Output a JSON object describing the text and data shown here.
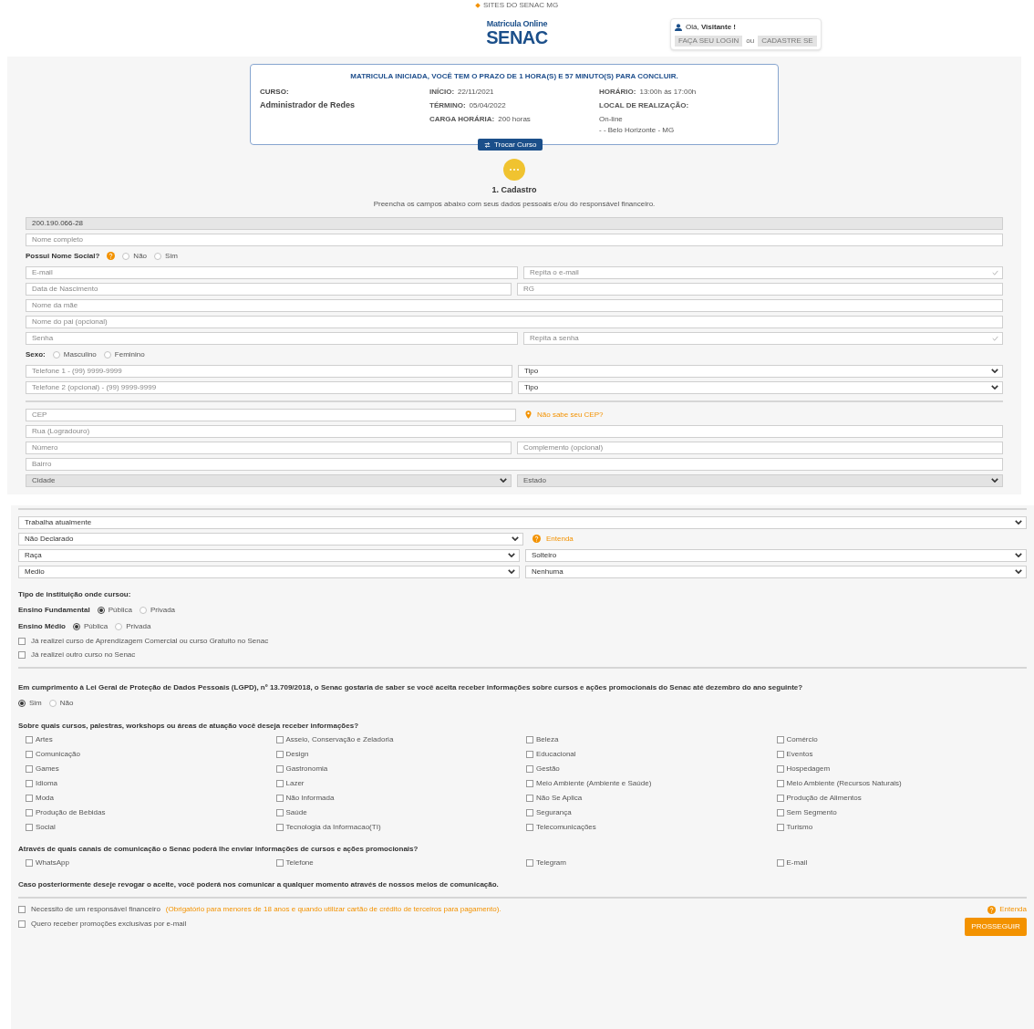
{
  "header": {
    "top_link": "SITES DO SENAC MG",
    "logo_line1": "Matricula Online",
    "logo_line2": "SENAC",
    "greeting": "Olá, **Visitante !**",
    "login_button": "FAÇA SEU LOGIN",
    "or": "ou",
    "register_button": "CADASTRE SE"
  },
  "enrollment": {
    "title": "MATRICULA INICIADA, VOCÊ TEM O PRAZO DE 1 HORA(S) E 57 MINUTO(S) PARA CONCLUIR.",
    "course_label": "CURSO:",
    "course": "Administrador de Redes",
    "details": [
      {
        "label": "INÍCIO:",
        "value": "22/11/2021"
      },
      {
        "label": "TÉRMINO:",
        "value": "05/04/2022"
      },
      {
        "label": "CARGA HORÁRIA:",
        "value": "200 horas"
      }
    ],
    "schedule": {
      "label": "HORÁRIO:",
      "value": "13:00h às 17:00h"
    },
    "location_label": "LOCAL DE REALIZAÇÃO:",
    "location_lines": [
      "On-line",
      "- - Belo Horizonte - MG"
    ],
    "change_button": "Trocar Curso"
  },
  "step": {
    "title": "1. Cadastro",
    "description": "Preencha os campos abaixo com seus dados pessoais e/ou do responsável financeiro."
  },
  "section_1": [
    {
      "kind": "fields",
      "fields": [
        {
          "kind": "input",
          "value": "200.190.066-28",
          "disabled": true
        }
      ]
    },
    {
      "kind": "fields",
      "fields": [
        {
          "kind": "input",
          "placeholder": "Nome completo"
        }
      ]
    },
    {
      "kind": "radios",
      "label": "Possui Nome Social?",
      "help": true,
      "options": [
        {
          "label": "Não",
          "selected": false
        },
        {
          "label": "Sim",
          "selected": false
        }
      ]
    },
    {
      "kind": "fields",
      "fields": [
        {
          "kind": "input",
          "placeholder": "E-mail"
        },
        {
          "kind": "confirm",
          "placeholder": "Repita o e-mail"
        }
      ]
    },
    {
      "kind": "fields",
      "fields": [
        {
          "kind": "input",
          "placeholder": "Data de Nascimento"
        },
        {
          "kind": "input",
          "placeholder": "RG"
        }
      ]
    },
    {
      "kind": "fields",
      "fields": [
        {
          "kind": "input",
          "placeholder": "Nome da mãe"
        }
      ]
    },
    {
      "kind": "fields",
      "fields": [
        {
          "kind": "input",
          "placeholder": "Nome do pai (opcional)"
        }
      ]
    },
    {
      "kind": "fields",
      "fields": [
        {
          "kind": "input",
          "placeholder": "Senha"
        },
        {
          "kind": "confirm",
          "placeholder": "Repita a senha"
        }
      ]
    },
    {
      "kind": "radios",
      "label": "Sexo:",
      "help": false,
      "options": [
        {
          "label": "Masculino",
          "selected": false
        },
        {
          "label": "Feminino",
          "selected": false
        }
      ]
    },
    {
      "kind": "fields",
      "fields": [
        {
          "kind": "input",
          "placeholder": "Telefone 1 - (99) 9999-9999"
        },
        {
          "kind": "select",
          "value": "Tipo"
        }
      ]
    },
    {
      "kind": "fields",
      "fields": [
        {
          "kind": "input",
          "placeholder": "Telefone 2 (opcional) - (99) 9999-9999"
        },
        {
          "kind": "select",
          "value": "Tipo"
        }
      ]
    },
    {
      "kind": "divider"
    },
    {
      "kind": "fields",
      "fields": [
        {
          "kind": "input",
          "placeholder": "CEP"
        },
        {
          "kind": "location-link",
          "text": "Não sabe seu CEP?"
        }
      ]
    },
    {
      "kind": "fields",
      "fields": [
        {
          "kind": "input",
          "placeholder": "Rua (Logradouro)"
        }
      ]
    },
    {
      "kind": "fields",
      "fields": [
        {
          "kind": "input",
          "placeholder": "Número"
        },
        {
          "kind": "input",
          "placeholder": "Complemento (opcional)"
        }
      ]
    },
    {
      "kind": "fields",
      "fields": [
        {
          "kind": "input",
          "placeholder": "Bairro"
        }
      ]
    },
    {
      "kind": "fields",
      "fields": [
        {
          "kind": "select",
          "value": "Cidade",
          "disabled": true
        },
        {
          "kind": "select",
          "value": "Estado",
          "disabled": true
        }
      ]
    }
  ],
  "section_2": [
    {
      "kind": "divider"
    },
    {
      "kind": "fields",
      "fields": [
        {
          "kind": "select",
          "value": "Trabalha atualmente"
        }
      ]
    },
    {
      "kind": "fields",
      "fields": [
        {
          "kind": "select",
          "value": "Não Declarado"
        },
        {
          "kind": "help-link",
          "text": "Entenda"
        }
      ]
    },
    {
      "kind": "fields",
      "fields": [
        {
          "kind": "select",
          "value": "Raça"
        },
        {
          "kind": "select",
          "value": "Solteiro"
        }
      ]
    },
    {
      "kind": "fields",
      "fields": [
        {
          "kind": "select",
          "value": "Medio"
        },
        {
          "kind": "select",
          "value": "Nenhuma"
        }
      ]
    },
    {
      "kind": "heading",
      "text": "Tipo de instituição onde cursou:"
    },
    {
      "kind": "radios",
      "label": "Ensino Fundamental",
      "help": false,
      "options": [
        {
          "label": "Pública",
          "selected": true
        },
        {
          "label": "Privada",
          "selected": false
        }
      ]
    },
    {
      "kind": "radios",
      "label": "Ensino Médio",
      "help": false,
      "options": [
        {
          "label": "Pública",
          "selected": true
        },
        {
          "label": "Privada",
          "selected": false
        }
      ]
    },
    {
      "kind": "checkbox",
      "label": "Já realizei curso de Aprendizagem Comercial ou curso Gratuito no Senac",
      "checked": false
    },
    {
      "kind": "checkbox",
      "label": "Já realizei outro curso no Senac",
      "checked": false
    },
    {
      "kind": "divider"
    },
    {
      "kind": "question",
      "text": "Em cumprimento à Lei Geral de Proteção de Dados Pessoais (LGPD), nº 13.709/2018, o Senac gostaria de saber se você aceita receber informações sobre cursos e ações promocionais do Senac até dezembro do ano seguinte?"
    },
    {
      "kind": "radios",
      "help": false,
      "options": [
        {
          "label": "Sim",
          "selected": true
        },
        {
          "label": "Não",
          "selected": false
        }
      ]
    },
    {
      "kind": "question",
      "text": "Sobre quais cursos, palestras, workshops ou áreas de atuação você deseja receber informações?"
    },
    {
      "kind": "checkgrid",
      "items": [
        {
          "label": "Artes",
          "checked": false
        },
        {
          "label": "Asseio, Conservação e Zeladoria",
          "checked": false
        },
        {
          "label": "Beleza",
          "checked": false
        },
        {
          "label": "Comércio",
          "checked": false
        },
        {
          "label": "Comunicação",
          "checked": false
        },
        {
          "label": "Design",
          "checked": false
        },
        {
          "label": "Educacional",
          "checked": false
        },
        {
          "label": "Eventos",
          "checked": false
        },
        {
          "label": "Games",
          "checked": false
        },
        {
          "label": "Gastronomia",
          "checked": false
        },
        {
          "label": "Gestão",
          "checked": false
        },
        {
          "label": "Hospedagem",
          "checked": false
        },
        {
          "label": "Idioma",
          "checked": false
        },
        {
          "label": "Lazer",
          "checked": false
        },
        {
          "label": "Meio Ambiente (Ambiente e Saúde)",
          "checked": false
        },
        {
          "label": "Meio Ambiente (Recursos Naturais)",
          "checked": false
        },
        {
          "label": "Moda",
          "checked": false
        },
        {
          "label": "Não Informada",
          "checked": false
        },
        {
          "label": "Não Se Aplica",
          "checked": false
        },
        {
          "label": "Produção de Alimentos",
          "checked": false
        },
        {
          "label": "Produção de Bebidas",
          "checked": false
        },
        {
          "label": "Saúde",
          "checked": false
        },
        {
          "label": "Segurança",
          "checked": false
        },
        {
          "label": "Sem Segmento",
          "checked": false
        },
        {
          "label": "Social",
          "checked": false
        },
        {
          "label": "Tecnologia da Informacao(TI)",
          "checked": false
        },
        {
          "label": "Telecomunicações",
          "checked": false
        },
        {
          "label": "Turismo",
          "checked": false
        }
      ]
    },
    {
      "kind": "question",
      "text": "Através de quais canais de comunicação o Senac poderá lhe enviar informações de cursos e ações promocionais?"
    },
    {
      "kind": "checkgrid",
      "items": [
        {
          "label": "WhatsApp",
          "checked": false
        },
        {
          "label": "Telefone",
          "checked": false
        },
        {
          "label": "Telegram",
          "checked": false
        },
        {
          "label": "E-mail",
          "checked": false
        }
      ]
    },
    {
      "kind": "question",
      "text": "Caso posteriormente deseje revogar o aceite, você poderá nos comunicar a qualquer momento através de nossos meios de comunicação."
    },
    {
      "kind": "divider"
    }
  ],
  "footer": {
    "financial": {
      "label": "Necessito de um responsável financeiro",
      "note": "(Obrigatório para menores de 18 anos e quando utilizar cartão de crédito de terceiros para pagamento).",
      "checked": false
    },
    "help_link": "Entenda",
    "promotions": {
      "label": "Quero receber promoções exclusivas por e-mail",
      "checked": false
    },
    "submit_button": "PROSSEGUIR"
  }
}
